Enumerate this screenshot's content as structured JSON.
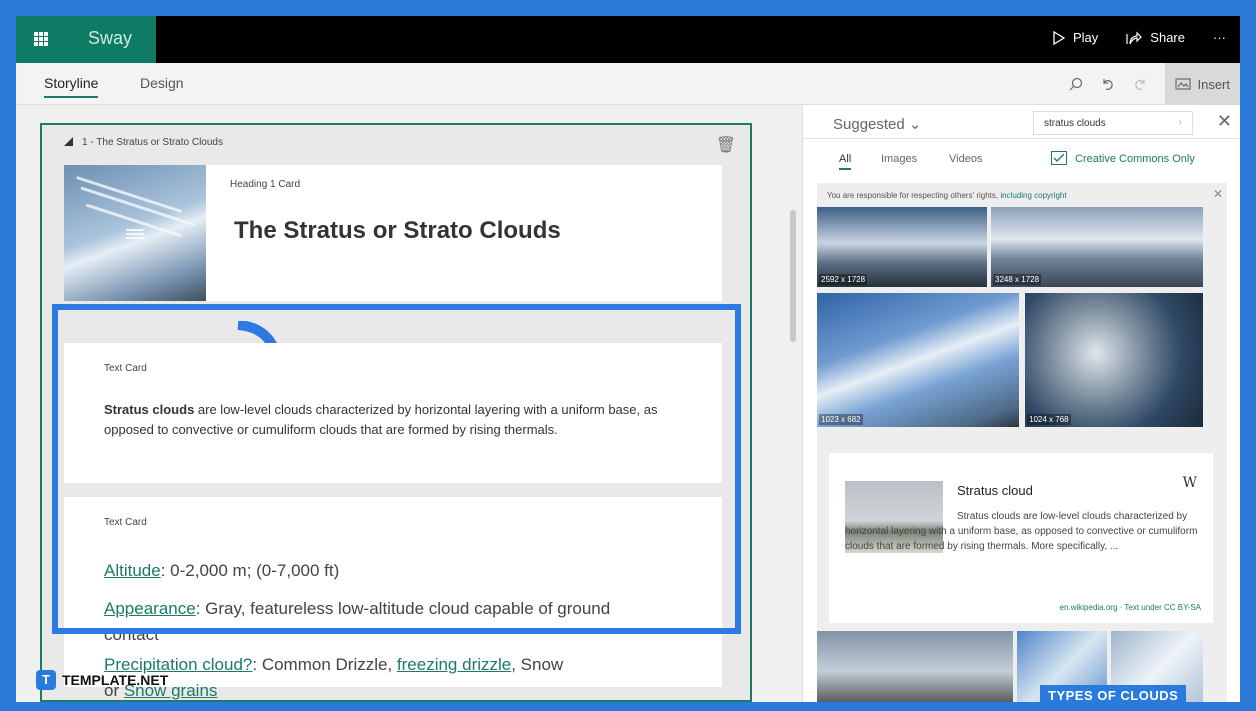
{
  "app": {
    "name": "Sway"
  },
  "topbar": {
    "play_label": "Play",
    "share_label": "Share",
    "more_label": "···"
  },
  "tabs": [
    {
      "label": "Storyline"
    },
    {
      "label": "Design"
    }
  ],
  "toolbar": {
    "insert_label": "Insert"
  },
  "section": {
    "title": "1 - The Stratus or Strato Clouds",
    "heading_card": {
      "type_label": "Heading 1 Card",
      "title": "The Stratus or Strato Clouds"
    },
    "text_card_1": {
      "type_label": "Text Card",
      "lead": "Stratus clouds",
      "body": " are low-level clouds characterized by horizontal layering with a uniform base, as opposed to convective or cumuliform clouds that are formed by rising thermals."
    },
    "text_card_2": {
      "type_label": "Text Card",
      "altitude_link": "Altitude",
      "altitude_value": ": 0-2,000 m; (0-7,000 ft)",
      "appearance_link": "Appearance",
      "appearance_value": ": Gray, featureless low-altitude cloud capable of ground contact",
      "precip_link": "Precipitation cloud?",
      "precip_value": ": Common Drizzle, ",
      "precip_link2": "freezing drizzle",
      "precip_value2": ", Snow",
      "precip_tail": "or ",
      "precip_link3": "Snow grains"
    }
  },
  "pane": {
    "source_label": "Suggested",
    "search_value": "stratus clouds",
    "filters": {
      "all": "All",
      "images": "Images",
      "videos": "Videos",
      "cc_only": "Creative Commons Only"
    },
    "notice": "You are responsible for respecting others' rights, ",
    "notice_link": "including copyright",
    "images": [
      {
        "dim": "2592 x 1728"
      },
      {
        "dim": "3248 x 1728"
      },
      {
        "dim": "1023 x 682"
      },
      {
        "dim": "1024 x 768"
      }
    ],
    "wiki": {
      "title": "Stratus cloud",
      "badge": "W",
      "text": "Stratus clouds are low-level clouds characterized by horizontal layering with a uniform base, as opposed to convective or cumuliform clouds that are formed by rising thermals. More specifically, ...",
      "source": "en.wikipedia.org · Text under CC BY-SA"
    },
    "bottom_badge": "TYPES OF CLOUDS"
  },
  "watermark": {
    "logo": "T",
    "text": "TEMPLATE.NET"
  }
}
